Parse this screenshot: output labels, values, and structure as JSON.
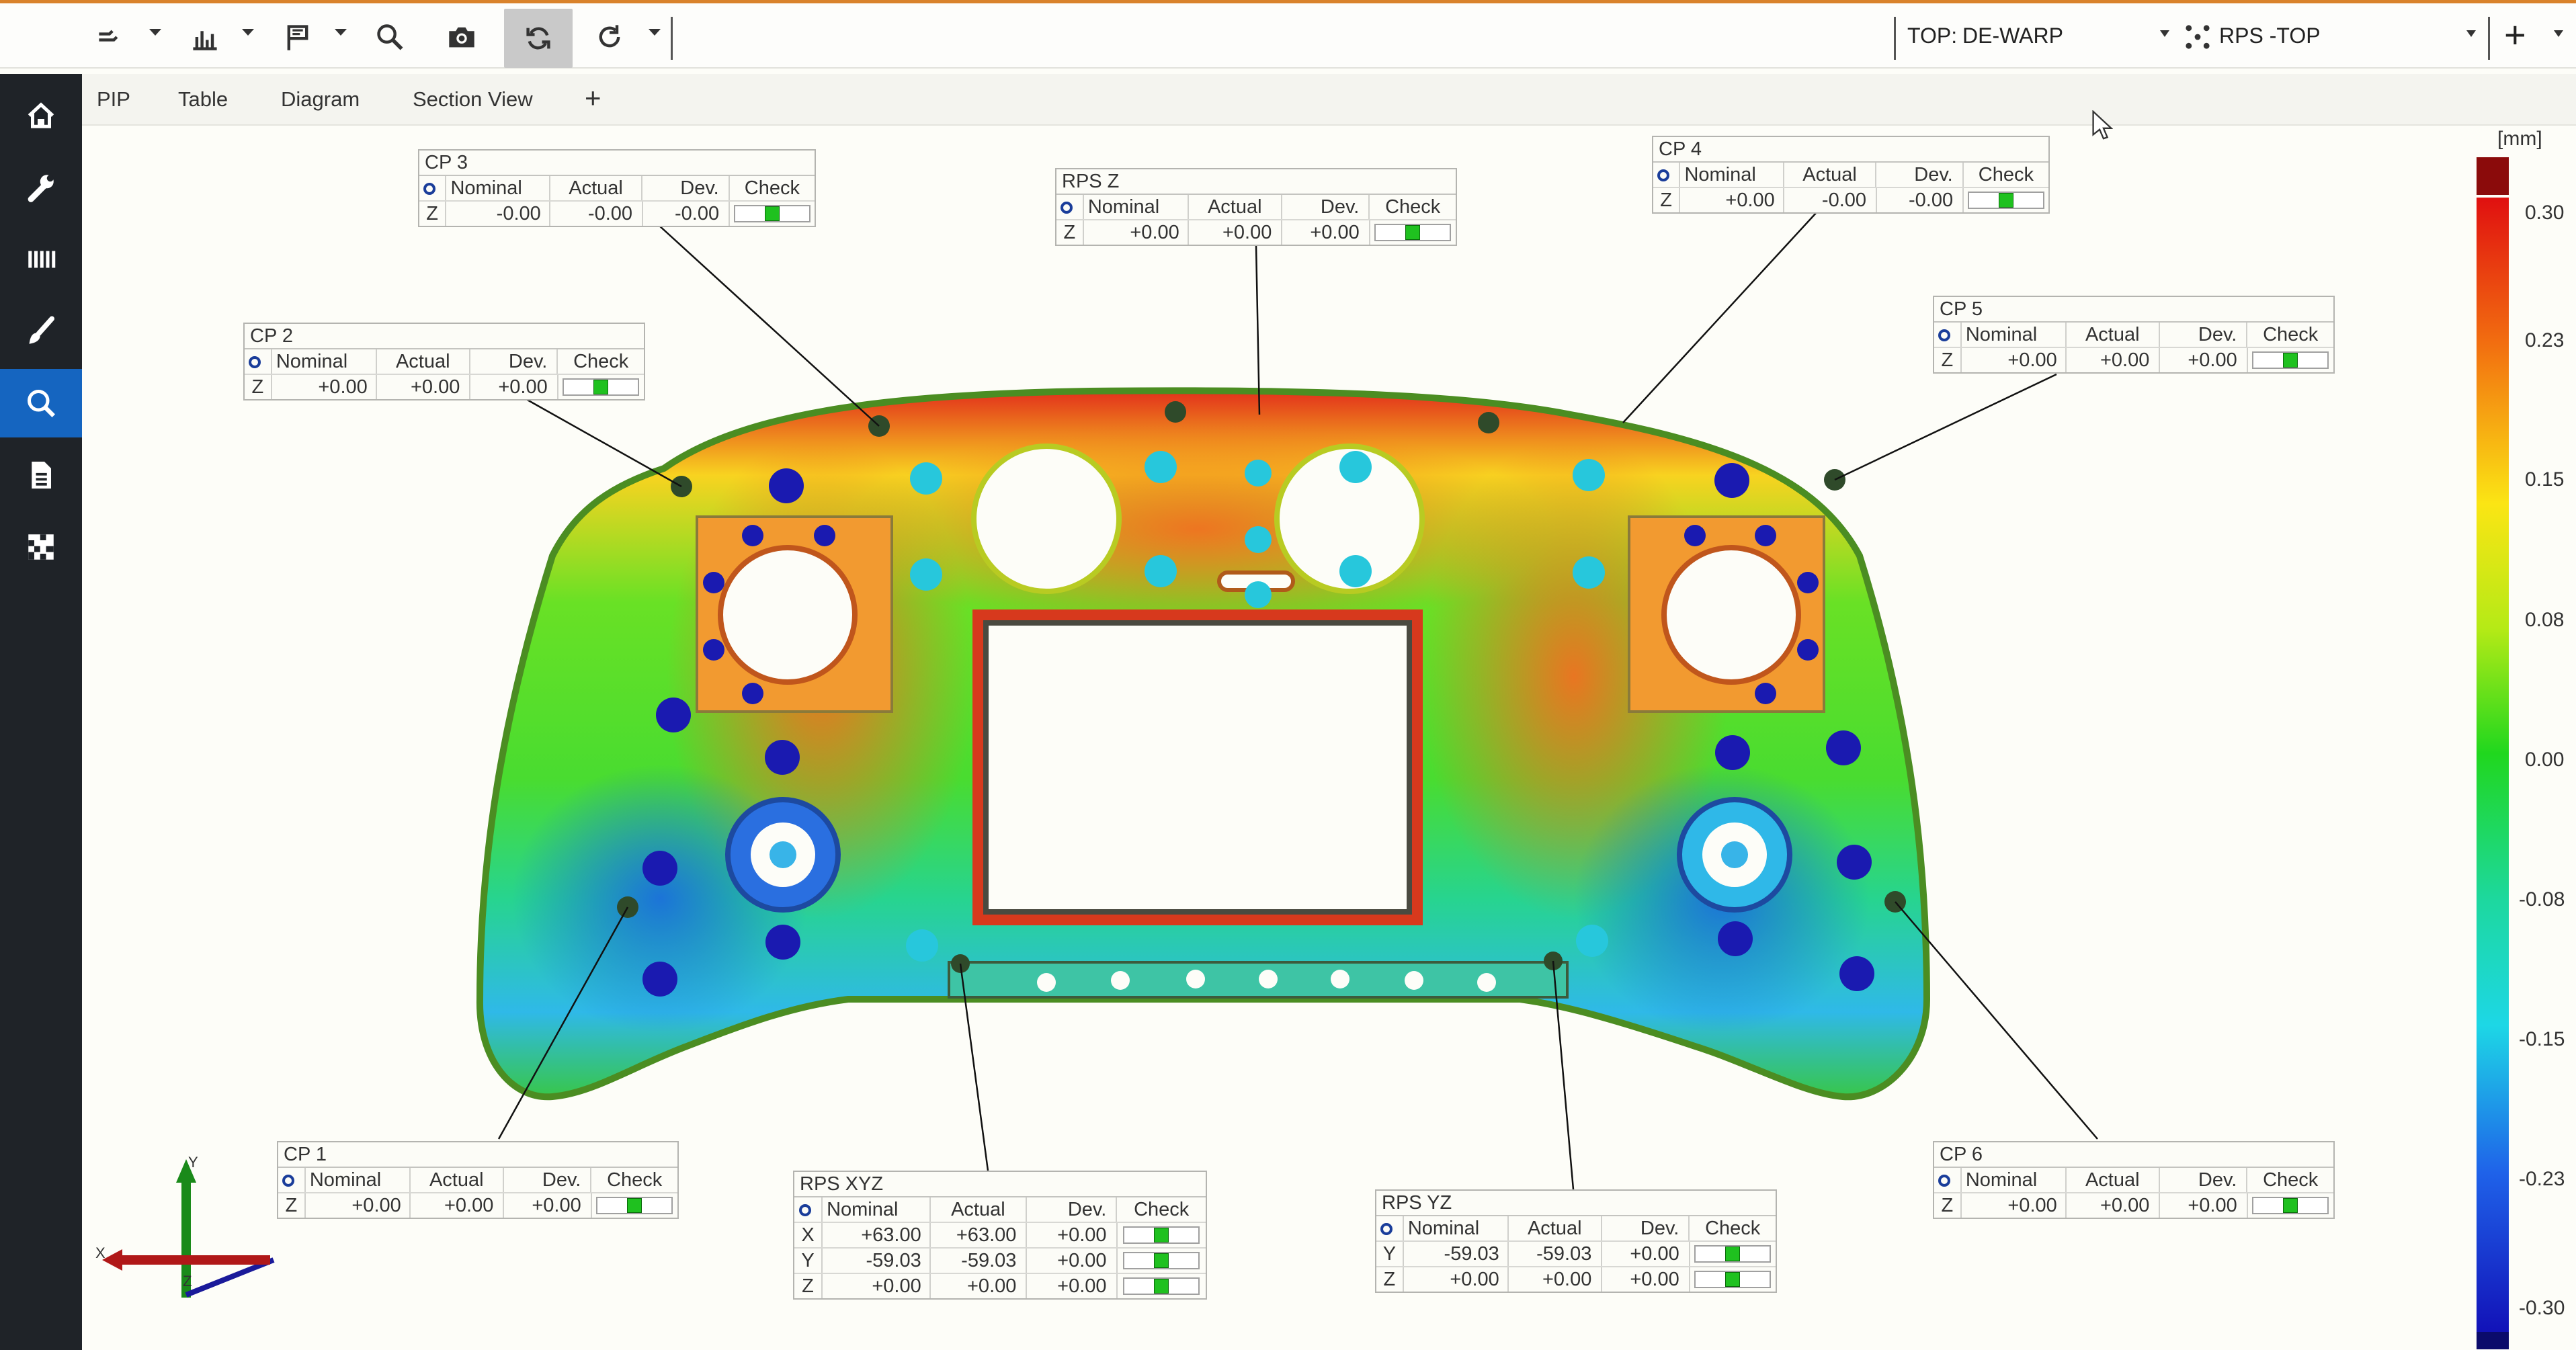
{
  "colors": {
    "accent": "#1565c0",
    "top_line": "#d9822b",
    "sidebar_bg": "#1f2328",
    "check_ok": "#1fc11f"
  },
  "toolbar": {
    "icons": [
      "align-icon",
      "chart-icon",
      "flag-icon",
      "search-icon",
      "camera-icon",
      "sync-icon",
      "refresh-icon"
    ],
    "alignment_prefix": "TOP:",
    "alignment_value": "DE-WARP",
    "rps_label": "RPS -TOP",
    "add_label": "+"
  },
  "sidebar": {
    "items": [
      "home-icon",
      "wrench-icon",
      "ruler-icon",
      "brush-icon",
      "search-icon",
      "document-icon",
      "pattern-icon"
    ],
    "active_index": 4
  },
  "tabs": {
    "items": [
      "PIP",
      "Table",
      "Diagram",
      "Section View"
    ],
    "add": "+"
  },
  "headers": {
    "nominal": "Nominal",
    "actual": "Actual",
    "dev": "Dev.",
    "check": "Check"
  },
  "annotations": {
    "cp3": {
      "title": "CP 3",
      "rows": [
        {
          "axis": "Z",
          "nominal": "-0.00",
          "actual": "-0.00",
          "dev": "-0.00"
        }
      ]
    },
    "rpsz": {
      "title": "RPS Z",
      "rows": [
        {
          "axis": "Z",
          "nominal": "+0.00",
          "actual": "+0.00",
          "dev": "+0.00"
        }
      ]
    },
    "cp4": {
      "title": "CP 4",
      "rows": [
        {
          "axis": "Z",
          "nominal": "+0.00",
          "actual": "-0.00",
          "dev": "-0.00"
        }
      ]
    },
    "cp2": {
      "title": "CP 2",
      "rows": [
        {
          "axis": "Z",
          "nominal": "+0.00",
          "actual": "+0.00",
          "dev": "+0.00"
        }
      ]
    },
    "cp5": {
      "title": "CP 5",
      "rows": [
        {
          "axis": "Z",
          "nominal": "+0.00",
          "actual": "+0.00",
          "dev": "+0.00"
        }
      ]
    },
    "cp1": {
      "title": "CP 1",
      "rows": [
        {
          "axis": "Z",
          "nominal": "+0.00",
          "actual": "+0.00",
          "dev": "+0.00"
        }
      ]
    },
    "rpsxyz": {
      "title": "RPS XYZ",
      "rows": [
        {
          "axis": "X",
          "nominal": "+63.00",
          "actual": "+63.00",
          "dev": "+0.00"
        },
        {
          "axis": "Y",
          "nominal": "-59.03",
          "actual": "-59.03",
          "dev": "+0.00"
        },
        {
          "axis": "Z",
          "nominal": "+0.00",
          "actual": "+0.00",
          "dev": "+0.00"
        }
      ]
    },
    "rpsyz": {
      "title": "RPS YZ",
      "rows": [
        {
          "axis": "Y",
          "nominal": "-59.03",
          "actual": "-59.03",
          "dev": "+0.00"
        },
        {
          "axis": "Z",
          "nominal": "+0.00",
          "actual": "+0.00",
          "dev": "+0.00"
        }
      ]
    },
    "cp6": {
      "title": "CP 6",
      "rows": [
        {
          "axis": "Z",
          "nominal": "+0.00",
          "actual": "+0.00",
          "dev": "+0.00"
        }
      ]
    }
  },
  "color_scale": {
    "unit": "[mm]",
    "ticks": [
      "0.30",
      "0.23",
      "0.15",
      "0.08",
      "0.00",
      "-0.08",
      "-0.15",
      "-0.23",
      "-0.30"
    ]
  },
  "triad": {
    "x": "X",
    "y": "Y",
    "z": "Z"
  }
}
